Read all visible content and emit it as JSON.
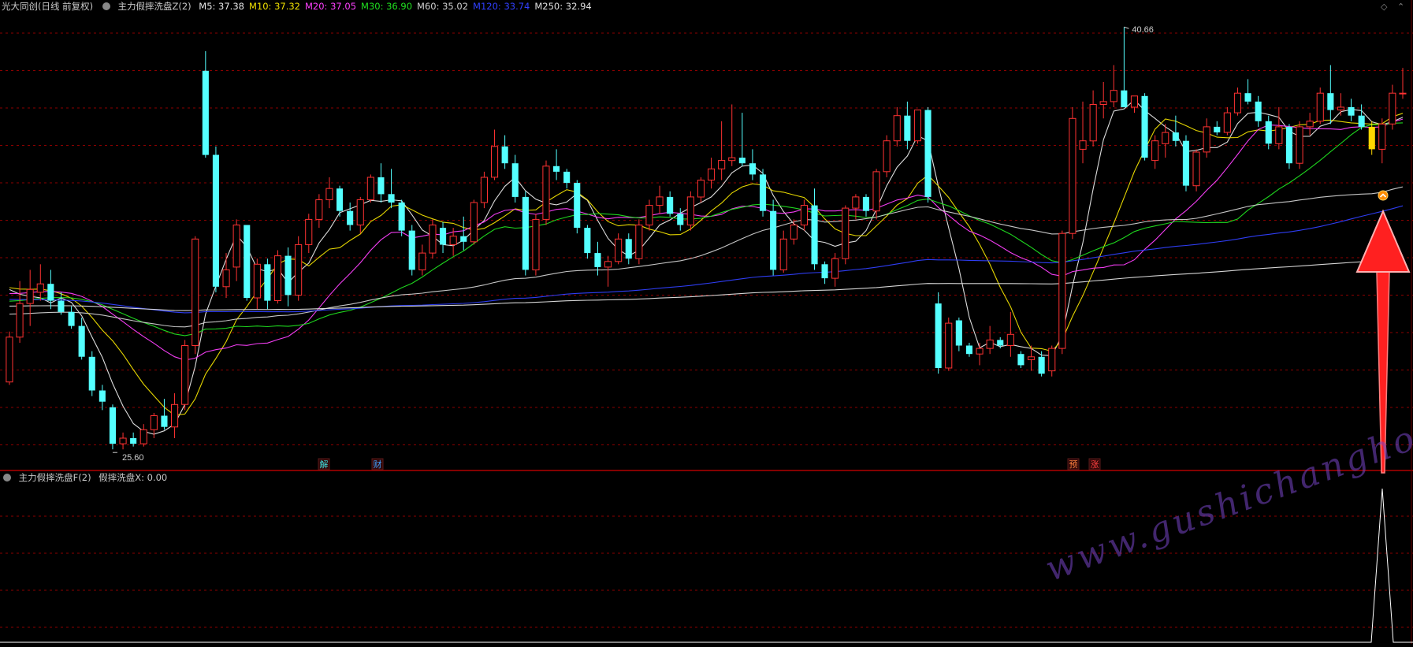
{
  "header": {
    "stock": "光大同创(日线 前复权)",
    "indicator": "主力假摔洗盘Z(2)",
    "ma": [
      {
        "label": "M5: 37.38",
        "color": "#e8e8e8"
      },
      {
        "label": "M10: 37.32",
        "color": "#f0e000"
      },
      {
        "label": "M20: 37.05",
        "color": "#ff40ff"
      },
      {
        "label": "M30: 36.90",
        "color": "#20e020"
      },
      {
        "label": "M60: 35.02",
        "color": "#d0d0d0"
      },
      {
        "label": "M120: 33.74",
        "color": "#3040ff"
      },
      {
        "label": "M250: 32.94",
        "color": "#e0e0e0"
      }
    ]
  },
  "sub_header": {
    "indicator": "主力假摔洗盘F(2)",
    "value_label": "假摔洗盘X: 0.00"
  },
  "markers": [
    {
      "text": "解",
      "color": "#40e0e0"
    },
    {
      "text": "财",
      "color": "#40a0ff"
    },
    {
      "text": "预",
      "color": "#ff8040"
    },
    {
      "text": "涨",
      "color": "#ff4040"
    }
  ],
  "watermark": "www.gushichanghong.com",
  "colors": {
    "up": "#ff3232",
    "down": "#54ffff",
    "grid": "#8b0000",
    "divider": "#b00000",
    "arrow": "#ff2020",
    "signal_candle": "#ffd700"
  },
  "chart_data": {
    "type": "candlestick",
    "high_label": "40.66",
    "low_label": "25.60",
    "ohlc": [
      [
        28.0,
        29.8,
        27.9,
        29.6
      ],
      [
        29.6,
        31.6,
        29.4,
        30.8
      ],
      [
        30.8,
        32.0,
        30.0,
        31.3
      ],
      [
        31.2,
        32.2,
        30.9,
        31.5
      ],
      [
        31.5,
        32.0,
        30.6,
        30.9
      ],
      [
        30.9,
        31.2,
        30.4,
        30.5
      ],
      [
        30.5,
        30.7,
        29.9,
        30.0
      ],
      [
        30.0,
        30.3,
        28.8,
        28.9
      ],
      [
        28.9,
        29.1,
        27.5,
        27.7
      ],
      [
        27.7,
        27.9,
        27.0,
        27.3
      ],
      [
        27.1,
        27.2,
        25.6,
        25.8
      ],
      [
        25.8,
        26.2,
        25.6,
        26.0
      ],
      [
        26.0,
        26.2,
        25.7,
        25.8
      ],
      [
        25.8,
        26.5,
        25.7,
        26.3
      ],
      [
        26.3,
        26.9,
        26.0,
        26.8
      ],
      [
        26.8,
        27.4,
        26.3,
        26.4
      ],
      [
        26.4,
        27.6,
        26.0,
        27.2
      ],
      [
        27.2,
        29.5,
        27.0,
        29.3
      ],
      [
        29.3,
        33.2,
        29.0,
        33.1
      ],
      [
        39.1,
        39.8,
        36.0,
        36.1
      ],
      [
        36.1,
        36.4,
        31.2,
        31.4
      ],
      [
        31.4,
        32.6,
        31.0,
        32.0
      ],
      [
        32.1,
        33.8,
        31.6,
        33.6
      ],
      [
        33.6,
        33.6,
        30.9,
        31.0
      ],
      [
        31.0,
        32.4,
        30.6,
        32.2
      ],
      [
        32.2,
        32.4,
        30.6,
        30.9
      ],
      [
        30.9,
        32.7,
        30.8,
        32.5
      ],
      [
        32.5,
        32.8,
        30.7,
        31.1
      ],
      [
        31.1,
        33.2,
        30.9,
        32.9
      ],
      [
        32.9,
        34.0,
        32.6,
        33.8
      ],
      [
        33.8,
        34.7,
        33.5,
        34.5
      ],
      [
        34.5,
        35.3,
        34.2,
        34.9
      ],
      [
        34.9,
        35.0,
        33.9,
        34.1
      ],
      [
        34.1,
        34.4,
        33.4,
        33.6
      ],
      [
        33.6,
        34.6,
        33.3,
        34.5
      ],
      [
        34.5,
        35.4,
        34.4,
        35.3
      ],
      [
        35.3,
        35.8,
        34.4,
        34.7
      ],
      [
        34.7,
        35.6,
        34.2,
        34.4
      ],
      [
        34.4,
        34.5,
        33.2,
        33.4
      ],
      [
        33.4,
        33.6,
        31.8,
        32.0
      ],
      [
        32.0,
        32.9,
        31.8,
        32.6
      ],
      [
        32.6,
        33.8,
        32.4,
        33.6
      ],
      [
        33.5,
        33.7,
        32.6,
        32.9
      ],
      [
        32.9,
        33.5,
        32.5,
        33.2
      ],
      [
        33.2,
        33.9,
        32.7,
        33.0
      ],
      [
        33.0,
        34.5,
        32.9,
        34.4
      ],
      [
        34.4,
        35.5,
        34.2,
        35.3
      ],
      [
        35.3,
        37.0,
        35.2,
        36.4
      ],
      [
        36.4,
        36.8,
        35.6,
        35.8
      ],
      [
        35.8,
        36.1,
        34.4,
        34.6
      ],
      [
        34.6,
        34.8,
        31.8,
        32.0
      ],
      [
        32.0,
        34.0,
        31.8,
        33.8
      ],
      [
        33.8,
        35.9,
        33.6,
        35.7
      ],
      [
        35.7,
        36.3,
        35.2,
        35.5
      ],
      [
        35.5,
        35.6,
        34.9,
        35.1
      ],
      [
        35.1,
        35.2,
        33.3,
        33.5
      ],
      [
        33.5,
        33.6,
        32.4,
        32.6
      ],
      [
        32.6,
        33.0,
        31.8,
        32.1
      ],
      [
        32.1,
        32.5,
        31.4,
        32.3
      ],
      [
        32.3,
        33.3,
        32.2,
        33.1
      ],
      [
        33.1,
        33.3,
        32.2,
        32.4
      ],
      [
        32.4,
        33.8,
        32.2,
        33.6
      ],
      [
        33.6,
        34.5,
        33.4,
        34.3
      ],
      [
        34.3,
        35.0,
        34.0,
        34.6
      ],
      [
        34.6,
        34.8,
        33.9,
        34.0
      ],
      [
        34.0,
        34.2,
        33.4,
        33.6
      ],
      [
        33.6,
        34.8,
        33.4,
        34.6
      ],
      [
        34.6,
        35.3,
        34.4,
        35.2
      ],
      [
        35.2,
        36.0,
        34.9,
        35.6
      ],
      [
        35.6,
        37.3,
        35.2,
        35.9
      ],
      [
        35.9,
        37.9,
        35.7,
        36.0
      ],
      [
        36.0,
        37.6,
        35.7,
        35.8
      ],
      [
        35.8,
        36.3,
        35.2,
        35.4
      ],
      [
        35.4,
        35.6,
        33.9,
        34.1
      ],
      [
        34.1,
        34.5,
        31.8,
        32.0
      ],
      [
        32.0,
        33.4,
        31.9,
        33.1
      ],
      [
        33.1,
        33.8,
        32.9,
        33.6
      ],
      [
        33.6,
        34.5,
        33.4,
        34.3
      ],
      [
        34.3,
        34.9,
        32.0,
        32.2
      ],
      [
        32.2,
        32.3,
        31.5,
        31.7
      ],
      [
        31.7,
        32.6,
        31.4,
        32.4
      ],
      [
        32.4,
        34.3,
        32.2,
        34.2
      ],
      [
        34.2,
        34.7,
        33.8,
        34.6
      ],
      [
        34.6,
        34.7,
        33.9,
        34.1
      ],
      [
        34.1,
        35.6,
        33.8,
        35.5
      ],
      [
        35.5,
        36.8,
        35.3,
        36.6
      ],
      [
        36.6,
        37.8,
        36.4,
        37.5
      ],
      [
        37.5,
        38.0,
        36.3,
        36.6
      ],
      [
        36.6,
        37.7,
        36.5,
        37.7
      ],
      [
        37.7,
        37.8,
        34.4,
        34.6
      ],
      [
        30.8,
        31.2,
        28.3,
        28.5
      ],
      [
        28.5,
        30.3,
        28.4,
        30.1
      ],
      [
        30.2,
        30.3,
        29.1,
        29.3
      ],
      [
        29.3,
        29.4,
        28.9,
        29.0
      ],
      [
        29.0,
        29.4,
        28.6,
        29.2
      ],
      [
        29.2,
        30.0,
        29.0,
        29.5
      ],
      [
        29.5,
        29.6,
        29.2,
        29.3
      ],
      [
        29.3,
        30.5,
        28.9,
        29.7
      ],
      [
        29.0,
        29.1,
        28.5,
        28.6
      ],
      [
        28.8,
        29.3,
        28.4,
        28.9
      ],
      [
        28.9,
        29.1,
        28.2,
        28.3
      ],
      [
        28.4,
        29.3,
        28.2,
        29.2
      ],
      [
        29.2,
        33.4,
        29.0,
        33.3
      ],
      [
        33.3,
        37.8,
        33.1,
        37.4
      ],
      [
        36.3,
        38.0,
        35.8,
        36.6
      ],
      [
        36.6,
        38.4,
        36.4,
        37.9
      ],
      [
        37.9,
        38.7,
        37.4,
        38.0
      ],
      [
        38.0,
        39.3,
        37.8,
        38.4
      ],
      [
        38.4,
        40.66,
        38.0,
        37.8
      ],
      [
        37.8,
        38.2,
        37.6,
        38.2
      ],
      [
        38.2,
        38.3,
        35.9,
        36.0
      ],
      [
        35.9,
        36.8,
        35.6,
        36.6
      ],
      [
        36.5,
        37.2,
        36.0,
        36.9
      ],
      [
        36.9,
        37.5,
        36.4,
        36.6
      ],
      [
        36.6,
        36.8,
        34.8,
        35.0
      ],
      [
        35.0,
        36.3,
        34.8,
        36.2
      ],
      [
        36.2,
        37.4,
        36.0,
        37.1
      ],
      [
        37.1,
        37.3,
        36.8,
        36.9
      ],
      [
        36.9,
        37.8,
        36.8,
        37.6
      ],
      [
        37.6,
        38.5,
        37.5,
        38.3
      ],
      [
        38.3,
        38.8,
        37.9,
        38.0
      ],
      [
        38.0,
        38.2,
        37.1,
        37.3
      ],
      [
        37.3,
        37.5,
        36.3,
        36.5
      ],
      [
        36.5,
        37.8,
        36.3,
        37.1
      ],
      [
        37.1,
        37.2,
        35.6,
        35.8
      ],
      [
        35.8,
        37.3,
        35.6,
        37.1
      ],
      [
        37.1,
        37.6,
        36.8,
        37.3
      ],
      [
        37.3,
        38.5,
        37.2,
        38.3
      ],
      [
        38.3,
        39.3,
        37.2,
        37.7
      ],
      [
        37.7,
        38.3,
        37.5,
        37.8
      ],
      [
        37.8,
        38.1,
        37.3,
        37.5
      ],
      [
        37.5,
        37.9,
        37.0,
        37.1
      ],
      [
        37.1,
        37.3,
        36.1,
        36.3
      ],
      [
        36.3,
        37.4,
        35.8,
        37.2
      ],
      [
        37.2,
        38.6,
        37.0,
        38.3
      ],
      [
        38.3,
        39.2,
        38.1,
        38.3
      ]
    ],
    "ma_periods": [
      5,
      10,
      20,
      30,
      60,
      120,
      250
    ]
  }
}
